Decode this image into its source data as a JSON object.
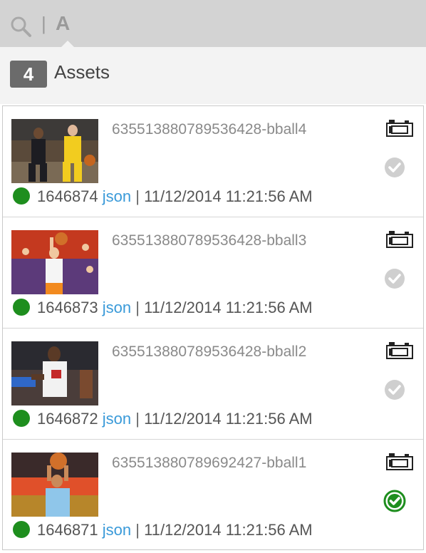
{
  "search": {
    "separator": "|",
    "mode_letter": "A"
  },
  "header": {
    "count": "4",
    "label": "Assets"
  },
  "colors": {
    "status_green": "#1e8e1e",
    "link_blue": "#3a9ad9",
    "check_selected": "#1e8e1e",
    "check_unselected": "#cfcfcf"
  },
  "items": [
    {
      "name": "635513880789536428-bball4",
      "id": "1646874",
      "format": "json",
      "sep": "|",
      "date": "11/12/2014 11:21:56 AM",
      "selected": false,
      "type_icon": "camera-icon"
    },
    {
      "name": "635513880789536428-bball3",
      "id": "1646873",
      "format": "json",
      "sep": "|",
      "date": "11/12/2014 11:21:56 AM",
      "selected": false,
      "type_icon": "camera-icon"
    },
    {
      "name": "635513880789536428-bball2",
      "id": "1646872",
      "format": "json",
      "sep": "|",
      "date": "11/12/2014 11:21:56 AM",
      "selected": false,
      "type_icon": "camera-icon"
    },
    {
      "name": "635513880789692427-bball1",
      "id": "1646871",
      "format": "json",
      "sep": "|",
      "date": "11/12/2014 11:21:56 AM",
      "selected": true,
      "type_icon": "camera-icon"
    }
  ]
}
